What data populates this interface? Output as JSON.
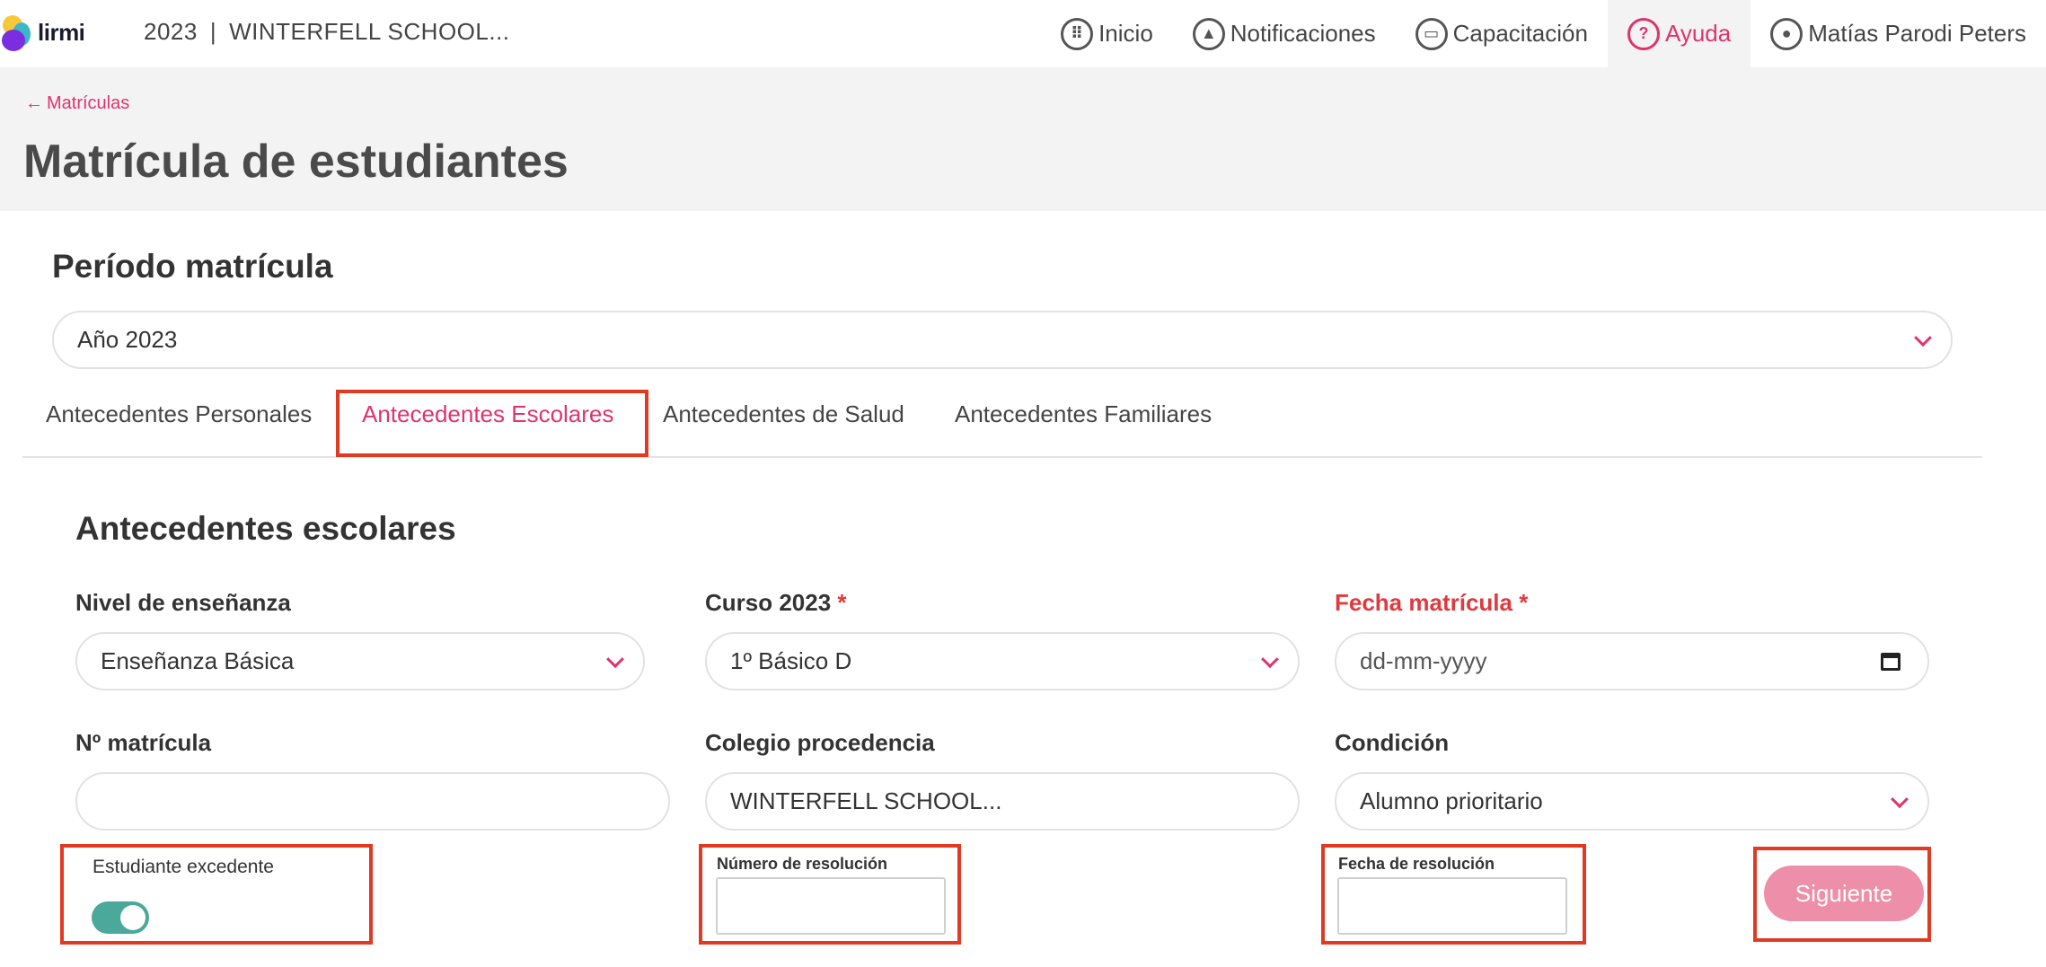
{
  "brand": {
    "logo_text": "lirmi"
  },
  "context": {
    "year": "2023",
    "separator": "|",
    "school": "WINTERFELL SCHOOL..."
  },
  "nav": {
    "items": [
      {
        "label": "Inicio",
        "icon": "grid-icon"
      },
      {
        "label": "Notificaciones",
        "icon": "bell-icon"
      },
      {
        "label": "Capacitación",
        "icon": "video-icon"
      },
      {
        "label": "Ayuda",
        "icon": "help-icon",
        "active": true
      },
      {
        "label": "Matías Parodi Peters",
        "icon": "user-icon"
      }
    ]
  },
  "breadcrumb": {
    "back_label": "Matrículas"
  },
  "page": {
    "title": "Matrícula de estudiantes"
  },
  "period": {
    "title": "Período matrícula",
    "selected": "Año 2023"
  },
  "tabs": [
    {
      "label": "Antecedentes Personales"
    },
    {
      "label": "Antecedentes Escolares",
      "active": true
    },
    {
      "label": "Antecedentes de Salud"
    },
    {
      "label": "Antecedentes Familiares"
    }
  ],
  "form": {
    "title": "Antecedentes escolares",
    "nivel": {
      "label": "Nivel de enseñanza",
      "value": "Enseñanza Básica"
    },
    "curso": {
      "label": "Curso 2023",
      "required": "*",
      "value": "1º Básico D"
    },
    "fecha_matricula": {
      "label": "Fecha matrícula",
      "required": "*",
      "placeholder": "dd-mm-yyyy"
    },
    "numero_matricula": {
      "label": "Nº matrícula",
      "value": ""
    },
    "colegio": {
      "label": "Colegio procedencia",
      "value": "WINTERFELL SCHOOL..."
    },
    "condicion": {
      "label": "Condición",
      "value": "Alumno prioritario"
    },
    "excedente": {
      "label": "Estudiante excedente",
      "enabled": true
    },
    "numero_resolucion": {
      "label": "Número de resolución",
      "value": ""
    },
    "fecha_resolucion": {
      "label": "Fecha de resolución",
      "value": ""
    },
    "next_label": "Siguiente"
  },
  "colors": {
    "accent": "#e0336e",
    "highlight": "#e03a22",
    "toggle_on": "#4aa99a",
    "button_disabled": "#ee8fa9"
  }
}
